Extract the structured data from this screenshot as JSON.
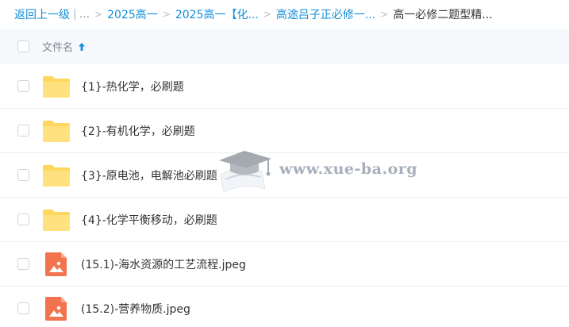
{
  "breadcrumb": {
    "back_label": "返回上一级",
    "separator_bar": "|",
    "ellipsis": "...",
    "items": [
      {
        "label": "2025高一"
      },
      {
        "label": "2025高一【化..."
      },
      {
        "label": "高途吕子正必修一..."
      }
    ],
    "current": "高一必修二题型精..."
  },
  "header": {
    "column_label": "文件名",
    "sort_direction": "ascending"
  },
  "files": [
    {
      "name": "{1}-热化学，必刷题",
      "icon": "folder-icon"
    },
    {
      "name": "{2}-有机化学，必刷题",
      "icon": "folder-icon"
    },
    {
      "name": "{3}-原电池，电解池必刷题",
      "icon": "folder-icon"
    },
    {
      "name": "{4}-化学平衡移动，必刷题",
      "icon": "folder-icon"
    },
    {
      "name": "(15.1)-海水资源的工艺流程.jpeg",
      "icon": "image-file-icon"
    },
    {
      "name": "(15.2)-营养物质.jpeg",
      "icon": "image-file-icon"
    }
  ],
  "watermark": {
    "text": "www.xue-ba.org"
  },
  "colors": {
    "link": "#0f8ed8",
    "folder": "#ffd75e",
    "image_icon": "#f2744f",
    "header_bg": "#f6f9fc"
  }
}
